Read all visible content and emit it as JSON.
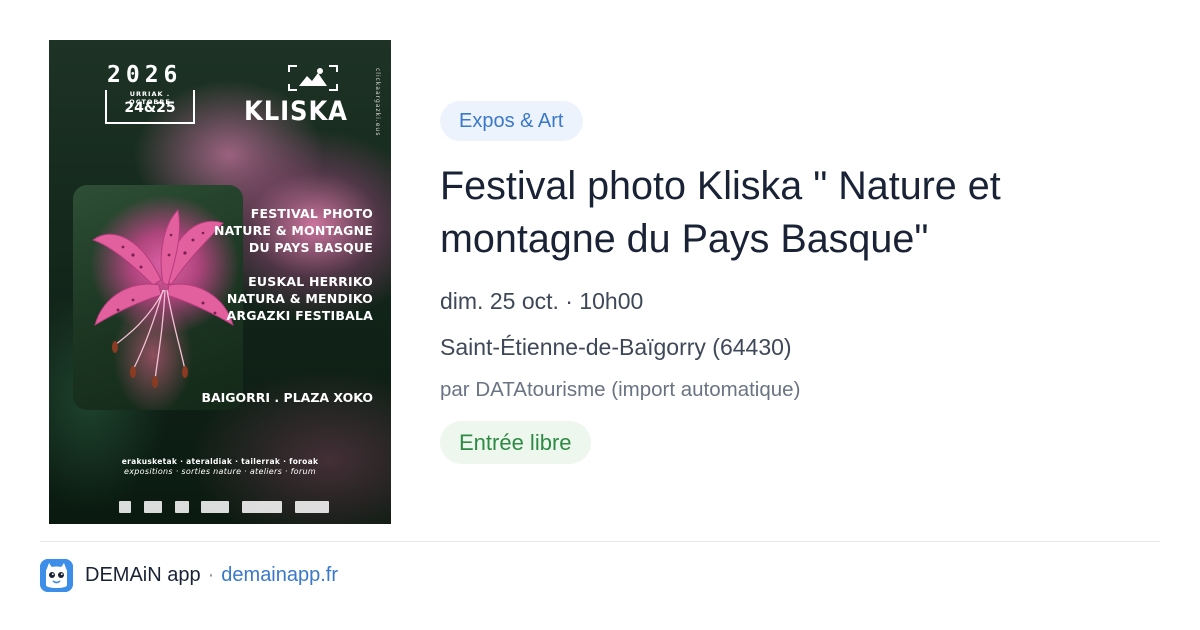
{
  "poster": {
    "year": "2026",
    "months": "URRIAK . OCTOBRE",
    "days": "24&25",
    "brand": "KLISKA",
    "website": "clickaargazki.eus",
    "headline_fr": [
      "FESTIVAL PHOTO",
      "NATURE & MONTAGNE",
      "DU PAYS BASQUE"
    ],
    "headline_eu": [
      "EUSKAL HERRIKO",
      "NATURA & MENDIKO",
      "ARGAZKI FESTIBALA"
    ],
    "venue": "BAIGORRI . PLAZA XOKO",
    "activities_eu": "erakusketak · ateraldiak · tailerrak · foroak",
    "activities_fr": "expositions · sorties nature · ateliers · forum",
    "colors": {
      "flower_pink": "#d862a8",
      "foliage_green": "#1e3325"
    }
  },
  "event": {
    "category": "Expos & Art",
    "title": "Festival photo Kliska \" Nature et montagne du Pays Basque\"",
    "when": "dim. 25 oct. · 10h00",
    "where": "Saint-Étienne-de-Baïgorry (64430)",
    "source": "par DATAtourisme (import automatique)",
    "price": "Entrée libre"
  },
  "footer": {
    "app_icon": "demain-app-icon",
    "app_name": "DEMAiN app",
    "separator": "·",
    "link": "demainapp.fr"
  },
  "colors": {
    "category_bg": "#edf3fc",
    "category_text": "#3a78c9",
    "price_bg": "#edf7ee",
    "price_text": "#2f8a46",
    "title_text": "#1a2335",
    "app_icon_bg": "#3c8ee8"
  }
}
